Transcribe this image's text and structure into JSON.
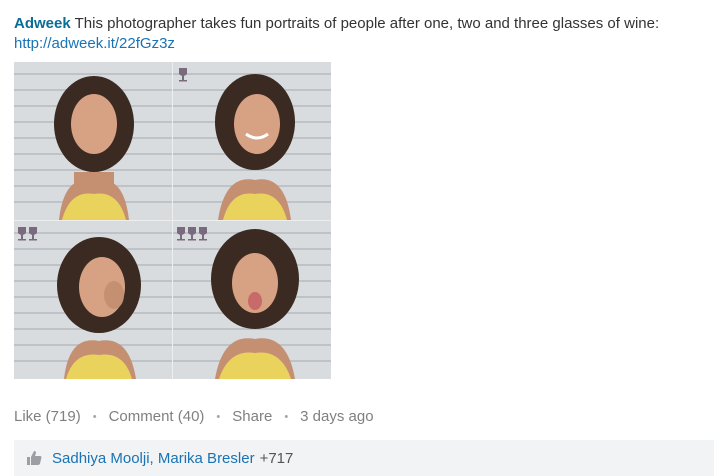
{
  "post": {
    "author": "Adweek",
    "text": "This photographer takes fun portraits of people after one, two and three glasses of wine:",
    "link": "http://adweek.it/22fGz3z"
  },
  "photos": [
    {
      "glasses": 0
    },
    {
      "glasses": 1
    },
    {
      "glasses": 2
    },
    {
      "glasses": 3
    }
  ],
  "actions": {
    "like": "Like (719)",
    "comment": "Comment (40)",
    "share": "Share",
    "time": "3 days ago",
    "separator": "•"
  },
  "likes": {
    "names": "Sadhiya Moolji, Marika Bresler",
    "more": "+717"
  }
}
